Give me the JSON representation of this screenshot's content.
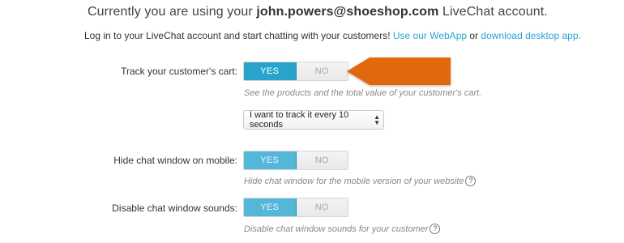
{
  "header": {
    "prefix": "Currently you are using your",
    "email": "john.powers@shoeshop.com",
    "suffix": "LiveChat account."
  },
  "intro": {
    "text": "Log in to your LiveChat account and start chatting with your customers!",
    "webapp_link": "Use our WebApp",
    "or": "or",
    "desktop_link": "download desktop app."
  },
  "settings": {
    "track_cart": {
      "label": "Track your customer's cart:",
      "yes": "YES",
      "no": "NO",
      "selected": "YES",
      "help": "See the products and the total value of your customer's cart.",
      "select_value": "I want to track it every 10 seconds"
    },
    "hide_mobile": {
      "label": "Hide chat window on mobile:",
      "yes": "YES",
      "no": "NO",
      "selected": "YES",
      "help": "Hide chat window for the mobile version of your website"
    },
    "disable_sounds": {
      "label": "Disable chat window sounds:",
      "yes": "YES",
      "no": "NO",
      "selected": "YES",
      "help": "Disable chat window sounds for your customer"
    }
  },
  "icons": {
    "help": "question-mark-icon",
    "pointer": "orange-arrow-pointer",
    "select_caret": "up-down-caret-icon"
  },
  "colors": {
    "accent": "#2aa3cc",
    "link": "#2aa4cf",
    "pointer": "#e2680f"
  }
}
